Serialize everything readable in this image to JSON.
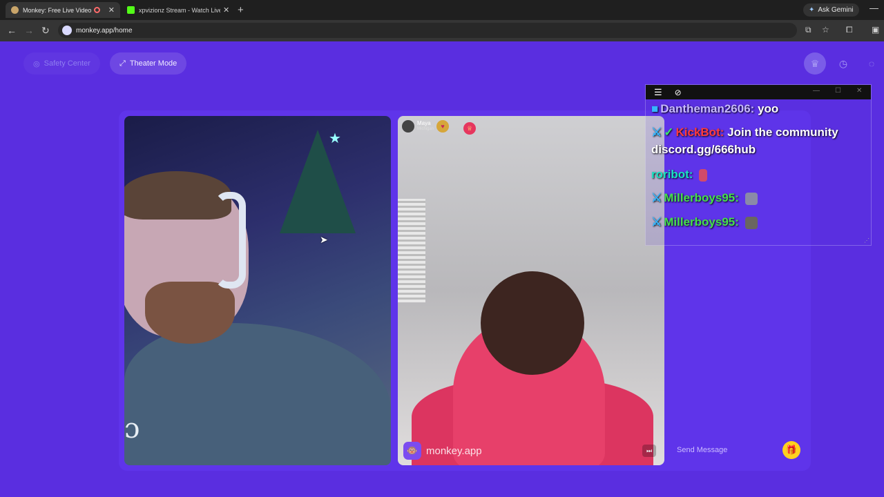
{
  "browser": {
    "tabs": [
      {
        "title": "Monkey: Free Live Video Ch",
        "active": true
      },
      {
        "title": "xpvizionz Stream - Watch Live o",
        "active": false
      }
    ],
    "ask_gemini": "Ask Gemini",
    "url": "monkey.app/home"
  },
  "header": {
    "safety_center": "Safety Center",
    "theater_mode": "Theater Mode"
  },
  "remote_user": {
    "name": "Maya",
    "location": "Michigan"
  },
  "watermark": "monkey.app",
  "send_placeholder": "Send Message",
  "chat": {
    "lines": [
      {
        "user": "Dantheman2606:",
        "text": "yoo"
      },
      {
        "user": "KickBot:",
        "text": "Join the community"
      },
      {
        "user": "",
        "text": "discord.gg/666hub"
      },
      {
        "user": "roribot:",
        "text": ""
      },
      {
        "user": "Millerboys95:",
        "text": ""
      },
      {
        "user": "Millerboys95:",
        "text": ""
      }
    ]
  },
  "colors": {
    "page_bg": "#5a2ee0",
    "accent_gift": "#ffd21f",
    "bot_name": "#ff3b3b",
    "user_green": "#46e04b"
  }
}
